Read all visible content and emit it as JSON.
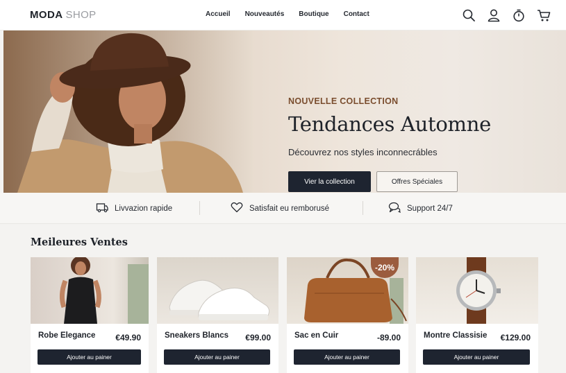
{
  "header": {
    "logo_main": "MODA",
    "logo_shop": "SHOP",
    "nav": [
      "Accueil",
      "Nouveautés",
      "Boutique",
      "Contact"
    ],
    "icons": [
      "search-icon",
      "user-icon",
      "timer-icon",
      "cart-icon"
    ]
  },
  "hero": {
    "label": "NOUVELLE COLLECTION",
    "title": "Tendances Automne",
    "subtitle": "Découvrez nos styles inconnecrábles",
    "primary_button": "Vier la collection",
    "secondary_button": "Offres Spéciales"
  },
  "features": [
    {
      "icon": "delivery-icon",
      "label": "Livvazion rapide"
    },
    {
      "icon": "heart-icon",
      "label": "Satisfait eu remborusé"
    },
    {
      "icon": "chat-icon",
      "label": "Support 24/7"
    }
  ],
  "best_sellers": {
    "title": "Meileures Ventes",
    "products": [
      {
        "name": "Robe Elegance",
        "price": "€49.90",
        "button": "Ajouter au painer"
      },
      {
        "name": "Sneakers Blancs",
        "price": "€99.00",
        "button": "Ajouter au painer"
      },
      {
        "name": "Sac en Cuir",
        "price": "-89.00",
        "badge": "-20%",
        "button": "Ajouter au painer"
      },
      {
        "name": "Montre Classisie",
        "price": "€129.00",
        "button": "Ajouter au painer"
      }
    ]
  },
  "colors": {
    "dark": "#1e2430",
    "accent_brown": "#7a4d2e",
    "badge": "#9b5c3e"
  }
}
